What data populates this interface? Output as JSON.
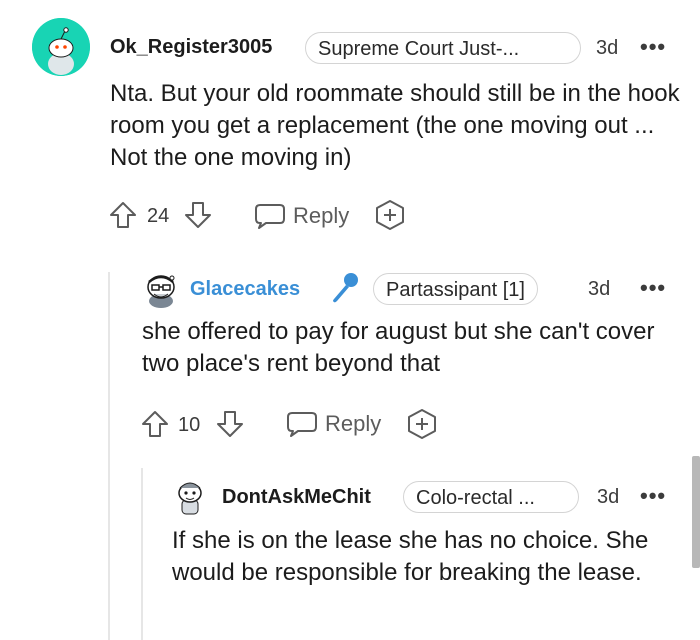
{
  "comments": [
    {
      "username": "Ok_Register3005",
      "flair": "Supreme Court Just-...",
      "age": "3d",
      "body": "Nta. But your old roommate should still be in the hook room you get a replacement (the one moving out ... Not the one moving in)",
      "votes": "24",
      "reply_label": "Reply"
    },
    {
      "username": "Glacecakes",
      "flair": "Partassipant [1]",
      "age": "3d",
      "body": "she offered to pay for august but she can't cover two place's rent beyond that",
      "votes": "10",
      "reply_label": "Reply"
    },
    {
      "username": "DontAskMeChit",
      "flair": "Colo-rectal ...",
      "age": "3d",
      "body": "If she is on the lease she has no choice. She would be responsible for breaking the lease."
    }
  ],
  "more_options": "•••",
  "colors": {
    "avatar_bg": "#18d4b4",
    "op_blue": "#3a8fd6",
    "thread_line": "#e6e6e6"
  },
  "icons": [
    "upvote-icon",
    "downvote-icon",
    "reply-bubble-icon",
    "add-award-icon",
    "microphone-icon"
  ]
}
